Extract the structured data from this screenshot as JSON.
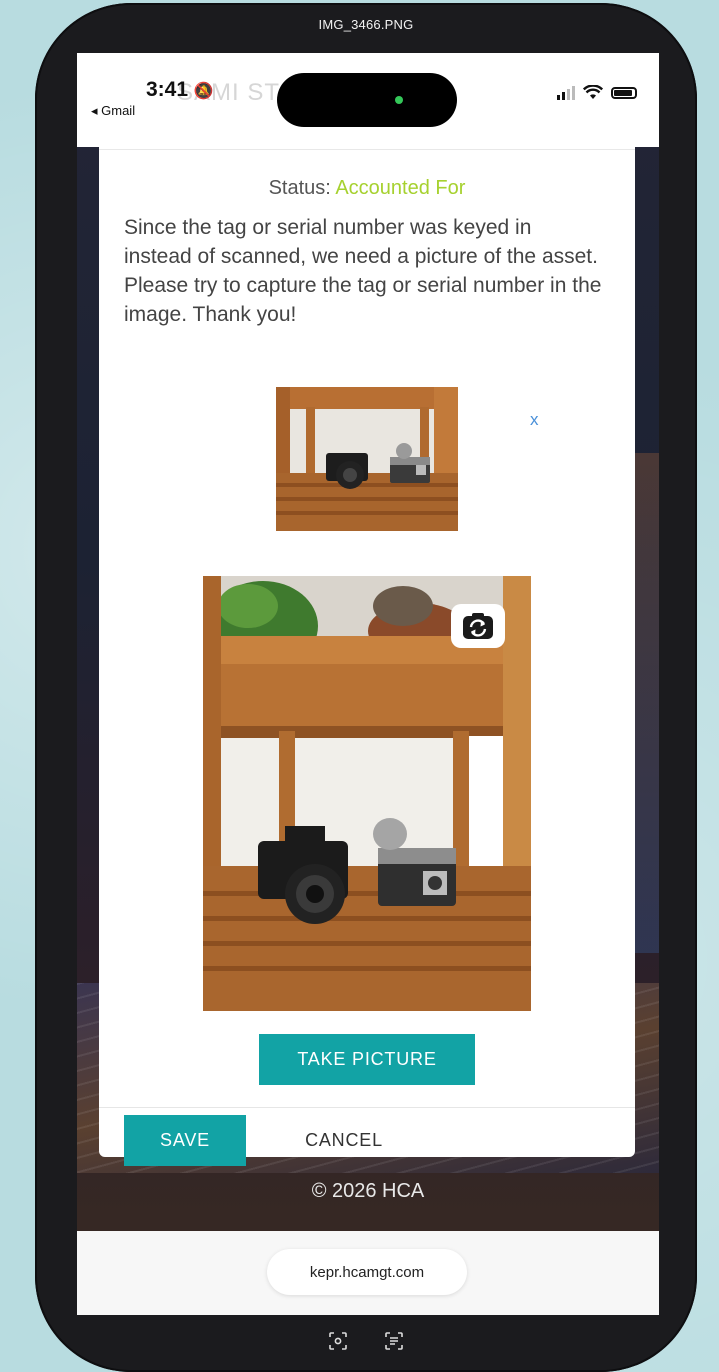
{
  "file_title": "IMG_3466.PNG",
  "status_bar": {
    "time": "3:41",
    "back_app": "◂ Gmail",
    "ghost_title": "SAMI ST        MPSMU"
  },
  "form": {
    "status_label": "Status:",
    "status_value": "Accounted For",
    "instructions": "Since the tag or serial number was keyed in instead of scanned, we need a picture of the asset. Please try to capture the tag or serial number in the image. Thank you!",
    "remove_label": "x",
    "take_picture_label": "TAKE PICTURE",
    "save_label": "SAVE",
    "cancel_label": "CANCEL"
  },
  "footer": {
    "copyright": "© 2026 HCA"
  },
  "browser": {
    "url": "kepr.hcamgt.com"
  },
  "colors": {
    "accent": "#12a3a5",
    "status": "#a6d12f",
    "link": "#4a90d9"
  },
  "icons": {
    "switch_camera": "switch-camera-icon",
    "bell_muted": "bell-slash-icon"
  }
}
